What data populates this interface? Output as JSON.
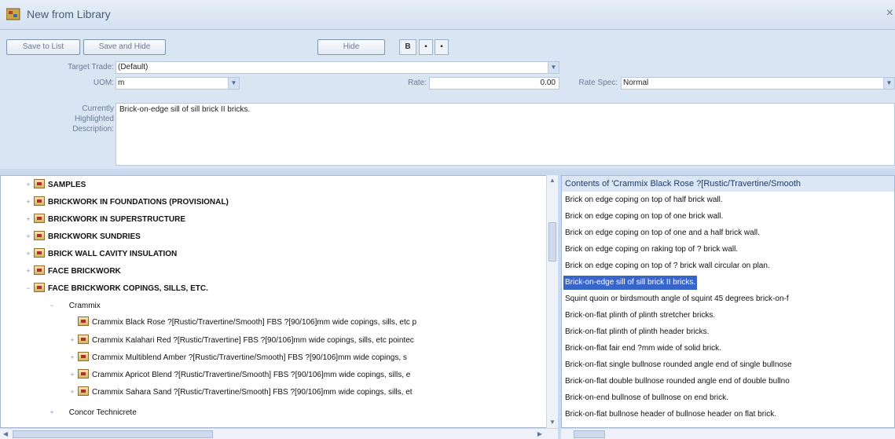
{
  "window": {
    "title": "New from Library",
    "close_glyph": "×"
  },
  "toolbar": {
    "save_to_list": "Save to List",
    "save_and_hide": "Save and Hide",
    "hide": "Hide",
    "bold_icon": "B",
    "icon_a": "▪",
    "icon_b": "▪"
  },
  "form": {
    "target_trade_label": "Target Trade:",
    "target_trade_value": "(Default)",
    "uom_label": "UOM:",
    "uom_value": "m",
    "rate_label": "Rate:",
    "rate_value": "0.00",
    "rate_spec_label": "Rate Spec:",
    "rate_spec_value": "Normal",
    "desc_label_1": "Currently",
    "desc_label_2": "Highlighted",
    "desc_label_3": "Description:",
    "description": "Brick-on-edge sill of sill brick II bricks."
  },
  "tree": {
    "items": [
      {
        "label": "SAMPLES",
        "expander": "+"
      },
      {
        "label": "BRICKWORK IN FOUNDATIONS (PROVISIONAL)",
        "expander": "+"
      },
      {
        "label": "BRICKWORK IN SUPERSTRUCTURE",
        "expander": "+"
      },
      {
        "label": "BRICKWORK SUNDRIES",
        "expander": "+"
      },
      {
        "label": "BRICK WALL CAVITY INSULATION",
        "expander": "+"
      },
      {
        "label": "FACE BRICKWORK",
        "expander": "+"
      },
      {
        "label": "FACE BRICKWORK COPINGS, SILLS, ETC.",
        "expander": "−"
      }
    ],
    "sub_group": "Crammix",
    "sub_items": [
      {
        "label": "Crammix Black Rose ?[Rustic/Travertine/Smooth] FBS ?[90/106]mm wide copings, sills, etc p",
        "expander": ""
      },
      {
        "label": "Crammix Kalahari Red ?[Rustic/Travertine] FBS ?[90/106]mm wide copings, sills, etc pointec",
        "expander": "+"
      },
      {
        "label": "Crammix Multiblend Amber ?[Rustic/Travertine/Smooth] FBS ?[90/106]mm wide copings, s",
        "expander": "+"
      },
      {
        "label": "Crammix Apricot Blend ?[Rustic/Travertine/Smooth] FBS ?[90/106]mm wide copings, sills, e",
        "expander": "+"
      },
      {
        "label": "Crammix Sahara Sand ?[Rustic/Travertine/Smooth] FBS ?[90/106]mm wide copings, sills, et",
        "expander": "+"
      }
    ],
    "next_group": "Concor Technicrete"
  },
  "contents": {
    "header": "Contents of 'Crammix Black Rose ?[Rustic/Travertine/Smooth",
    "items": [
      "Brick on edge coping on top of half brick wall.",
      "Brick on edge coping on top of one brick wall.",
      "Brick on edge coping on top of one and a half brick wall.",
      "Brick on edge coping on raking top of ? brick wall.",
      "Brick on edge coping on top of ? brick wall circular on plan.",
      "Brick-on-edge sill of sill brick II bricks.",
      "Squint quoin or birdsmouth angle of squint 45 degrees brick-on-f",
      "Brick-on-flat plinth of plinth stretcher bricks.",
      "Brick-on-flat plinth of plinth header bricks.",
      "Brick-on-flat fair end ?mm wide of solid brick.",
      "Brick-on-flat single bullnose rounded angle end of single bullnose",
      "Brick-on-flat double bullnose rounded angle end of double bullno",
      "Brick-on-end bullnose of bullnose on end brick.",
      "Brick-on-flat bullnose header of bullnose header on flat brick."
    ],
    "selected_index": 5
  },
  "colors": {
    "selection": "#3865c9",
    "panel": "#dae5f4"
  }
}
